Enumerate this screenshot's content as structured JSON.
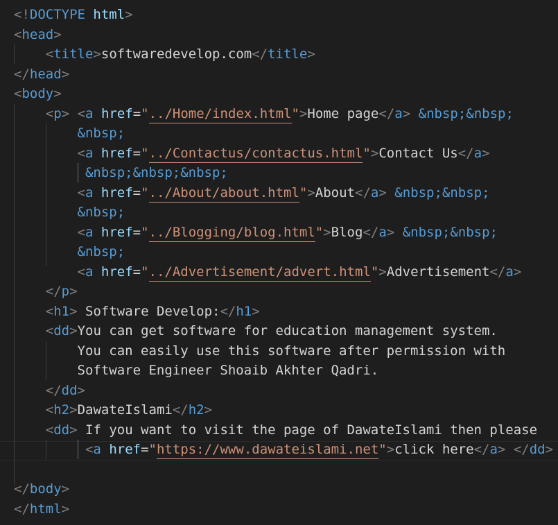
{
  "editor": {
    "lines": [
      {
        "parts": [
          [
            "t-punc",
            "<!"
          ],
          [
            "t-tag",
            "DOCTYPE"
          ],
          [
            "t-text",
            " "
          ],
          [
            "t-attr",
            "html"
          ],
          [
            "t-punc",
            ">"
          ]
        ]
      },
      {
        "parts": [
          [
            "t-punc",
            "<"
          ],
          [
            "t-tag",
            "head"
          ],
          [
            "t-punc",
            ">"
          ]
        ]
      },
      {
        "parts": [
          [
            "t-text",
            "    "
          ],
          [
            "t-punc",
            "<"
          ],
          [
            "t-tag",
            "title"
          ],
          [
            "t-punc",
            ">"
          ],
          [
            "t-text",
            "softwaredevelop.com"
          ],
          [
            "t-punc",
            "</"
          ],
          [
            "t-tag",
            "title"
          ],
          [
            "t-punc",
            ">"
          ]
        ]
      },
      {
        "parts": [
          [
            "t-punc",
            "</"
          ],
          [
            "t-tag",
            "head"
          ],
          [
            "t-punc",
            ">"
          ]
        ]
      },
      {
        "parts": [
          [
            "t-punc",
            "<"
          ],
          [
            "t-tag",
            "body"
          ],
          [
            "t-punc",
            ">"
          ]
        ]
      },
      {
        "parts": [
          [
            "t-text",
            "    "
          ],
          [
            "t-punc",
            "<"
          ],
          [
            "t-tag",
            "p"
          ],
          [
            "t-punc",
            ">"
          ],
          [
            "t-text",
            " "
          ],
          [
            "t-punc",
            "<"
          ],
          [
            "t-tag",
            "a"
          ],
          [
            "t-text",
            " "
          ],
          [
            "t-attr",
            "href"
          ],
          [
            "t-text",
            "="
          ],
          [
            "t-strq",
            "\""
          ],
          [
            "t-str",
            "../Home/index.html"
          ],
          [
            "t-strq",
            "\""
          ],
          [
            "t-punc",
            ">"
          ],
          [
            "t-text",
            "Home page"
          ],
          [
            "t-punc",
            "</"
          ],
          [
            "t-tag",
            "a"
          ],
          [
            "t-punc",
            ">"
          ],
          [
            "t-text",
            " "
          ],
          [
            "t-ent",
            "&nbsp;&nbsp;"
          ]
        ]
      },
      {
        "parts": [
          [
            "t-text",
            "        "
          ],
          [
            "t-ent",
            "&nbsp;"
          ]
        ]
      },
      {
        "parts": [
          [
            "t-text",
            "        "
          ],
          [
            "t-punc",
            "<"
          ],
          [
            "t-tag",
            "a"
          ],
          [
            "t-text",
            " "
          ],
          [
            "t-attr",
            "href"
          ],
          [
            "t-text",
            "="
          ],
          [
            "t-strq",
            "\""
          ],
          [
            "t-str",
            "../Contactus/contactus.html"
          ],
          [
            "t-strq",
            "\""
          ],
          [
            "t-punc",
            ">"
          ],
          [
            "t-text",
            "Contact Us"
          ],
          [
            "t-punc",
            "</"
          ],
          [
            "t-tag",
            "a"
          ],
          [
            "t-punc",
            ">"
          ]
        ]
      },
      {
        "parts": [
          [
            "t-text",
            "         "
          ],
          [
            "t-ent",
            "&nbsp;&nbsp;&nbsp;"
          ]
        ]
      },
      {
        "parts": [
          [
            "t-text",
            "        "
          ],
          [
            "t-punc",
            "<"
          ],
          [
            "t-tag",
            "a"
          ],
          [
            "t-text",
            " "
          ],
          [
            "t-attr",
            "href"
          ],
          [
            "t-text",
            "="
          ],
          [
            "t-strq",
            "\""
          ],
          [
            "t-str",
            "../About/about.html"
          ],
          [
            "t-strq",
            "\""
          ],
          [
            "t-punc",
            ">"
          ],
          [
            "t-text",
            "About"
          ],
          [
            "t-punc",
            "</"
          ],
          [
            "t-tag",
            "a"
          ],
          [
            "t-punc",
            ">"
          ],
          [
            "t-text",
            " "
          ],
          [
            "t-ent",
            "&nbsp;&nbsp;"
          ]
        ]
      },
      {
        "parts": [
          [
            "t-text",
            "        "
          ],
          [
            "t-ent",
            "&nbsp;"
          ]
        ]
      },
      {
        "parts": [
          [
            "t-text",
            "        "
          ],
          [
            "t-punc",
            "<"
          ],
          [
            "t-tag",
            "a"
          ],
          [
            "t-text",
            " "
          ],
          [
            "t-attr",
            "href"
          ],
          [
            "t-text",
            "="
          ],
          [
            "t-strq",
            "\""
          ],
          [
            "t-str",
            "../Blogging/blog.html"
          ],
          [
            "t-strq",
            "\""
          ],
          [
            "t-punc",
            ">"
          ],
          [
            "t-text",
            "Blog"
          ],
          [
            "t-punc",
            "</"
          ],
          [
            "t-tag",
            "a"
          ],
          [
            "t-punc",
            ">"
          ],
          [
            "t-text",
            " "
          ],
          [
            "t-ent",
            "&nbsp;&nbsp;"
          ]
        ]
      },
      {
        "parts": [
          [
            "t-text",
            "        "
          ],
          [
            "t-ent",
            "&nbsp;"
          ]
        ]
      },
      {
        "parts": [
          [
            "t-text",
            "        "
          ],
          [
            "t-punc",
            "<"
          ],
          [
            "t-tag",
            "a"
          ],
          [
            "t-text",
            " "
          ],
          [
            "t-attr",
            "href"
          ],
          [
            "t-text",
            "="
          ],
          [
            "t-strq",
            "\""
          ],
          [
            "t-str",
            "../Advertisement/advert.html"
          ],
          [
            "t-strq",
            "\""
          ],
          [
            "t-punc",
            ">"
          ],
          [
            "t-text",
            "Advertisement"
          ],
          [
            "t-punc",
            "</"
          ],
          [
            "t-tag",
            "a"
          ],
          [
            "t-punc",
            ">"
          ]
        ]
      },
      {
        "parts": [
          [
            "t-text",
            "    "
          ],
          [
            "t-punc",
            "</"
          ],
          [
            "t-tag",
            "p"
          ],
          [
            "t-punc",
            ">"
          ]
        ]
      },
      {
        "parts": [
          [
            "t-text",
            "    "
          ],
          [
            "t-punc",
            "<"
          ],
          [
            "t-tag",
            "h1"
          ],
          [
            "t-punc",
            ">"
          ],
          [
            "t-text",
            " Software Develop:"
          ],
          [
            "t-punc",
            "</"
          ],
          [
            "t-tag",
            "h1"
          ],
          [
            "t-punc",
            ">"
          ]
        ]
      },
      {
        "parts": [
          [
            "t-text",
            "    "
          ],
          [
            "t-punc",
            "<"
          ],
          [
            "t-tag",
            "dd"
          ],
          [
            "t-punc",
            ">"
          ],
          [
            "t-text",
            "You can get software for education management system."
          ]
        ]
      },
      {
        "parts": [
          [
            "t-text",
            "        You can easily use this software after permission with"
          ]
        ]
      },
      {
        "parts": [
          [
            "t-text",
            "        Software Engineer Shoaib Akhter Qadri."
          ]
        ]
      },
      {
        "parts": [
          [
            "t-text",
            "    "
          ],
          [
            "t-punc",
            "</"
          ],
          [
            "t-tag",
            "dd"
          ],
          [
            "t-punc",
            ">"
          ]
        ]
      },
      {
        "parts": [
          [
            "t-text",
            "    "
          ],
          [
            "t-punc",
            "<"
          ],
          [
            "t-tag",
            "h2"
          ],
          [
            "t-punc",
            ">"
          ],
          [
            "t-text",
            "DawateIslami"
          ],
          [
            "t-punc",
            "</"
          ],
          [
            "t-tag",
            "h2"
          ],
          [
            "t-punc",
            ">"
          ]
        ]
      },
      {
        "parts": [
          [
            "t-text",
            "    "
          ],
          [
            "t-punc",
            "<"
          ],
          [
            "t-tag",
            "dd"
          ],
          [
            "t-punc",
            ">"
          ],
          [
            "t-text",
            " If you want to visit the page of DawateIslami then please"
          ]
        ]
      },
      {
        "parts": [
          [
            "t-text",
            "         "
          ],
          [
            "t-punc",
            "<"
          ],
          [
            "t-tag",
            "a"
          ],
          [
            "t-text",
            " "
          ],
          [
            "t-attr",
            "href"
          ],
          [
            "t-text",
            "="
          ],
          [
            "t-strq",
            "\""
          ],
          [
            "t-str",
            "https://www.dawateislami.net"
          ],
          [
            "t-strq",
            "\""
          ],
          [
            "t-punc",
            ">"
          ],
          [
            "t-text",
            "click here"
          ],
          [
            "t-punc",
            "</"
          ],
          [
            "t-tag",
            "a"
          ],
          [
            "t-punc",
            ">"
          ],
          [
            "t-text",
            " "
          ],
          [
            "t-punc",
            "</"
          ],
          [
            "t-tag",
            "dd"
          ],
          [
            "t-punc",
            ">"
          ]
        ]
      },
      {
        "parts": [
          [
            "t-text",
            ""
          ]
        ]
      },
      {
        "parts": [
          [
            "t-punc",
            "</"
          ],
          [
            "t-tag",
            "body"
          ],
          [
            "t-punc",
            ">"
          ]
        ]
      },
      {
        "parts": [
          [
            "t-punc",
            "</"
          ],
          [
            "t-tag",
            "html"
          ],
          [
            "t-punc",
            ">"
          ]
        ]
      }
    ]
  }
}
